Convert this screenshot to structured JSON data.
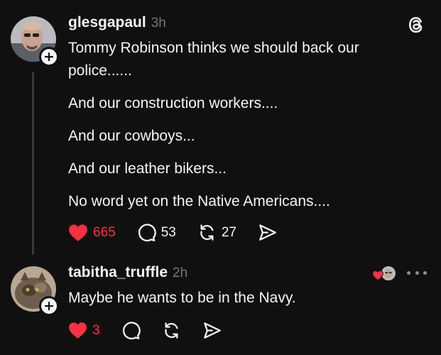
{
  "post": {
    "username": "glesgapaul",
    "time": "3h",
    "paragraphs": [
      "Tommy Robinson thinks we should back our police......",
      "And our construction workers....",
      "And our cowboys...",
      "And our leather bikers...",
      "No word yet on the Native Americans...."
    ],
    "likes": "665",
    "replies": "53",
    "reposts": "27"
  },
  "reply": {
    "username": "tabitha_truffle",
    "time": "2h",
    "text": "Maybe he wants to be in the Navy.",
    "likes": "3"
  },
  "colors": {
    "background": "#101010",
    "text": "#f3f5f7",
    "muted": "#777777",
    "like_red": "#ff3040"
  },
  "icons": {
    "app": "threads-logo-icon",
    "like": "heart-icon",
    "reply": "comment-bubble-icon",
    "repost": "repost-icon",
    "share": "send-icon",
    "follow": "plus-icon",
    "more": "more-dots-icon"
  }
}
